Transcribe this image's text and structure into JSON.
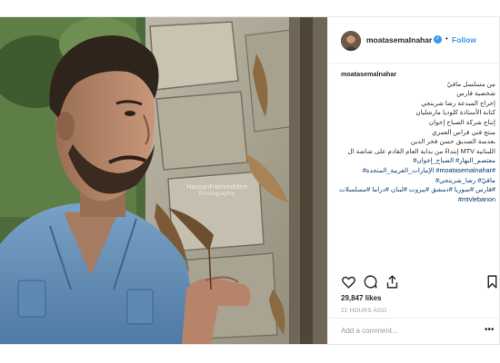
{
  "post": {
    "username": "moatasemalnahar",
    "follow_label": "Follow",
    "separator": "•",
    "verified_icon": "verified-badge-icon",
    "photo": {
      "watermark_name": "HassanFakhreddine",
      "watermark_sub": "Photography"
    },
    "caption": {
      "username": "moatasemalnahar",
      "lines": [
        "من مسلسل مافيّ",
        "شخصية فارس",
        "إخراج المبدعة رشا شربتجي",
        "كتابة الأستاذة كلوديا مارشليان",
        "إنتاج شركة الصباح إخوان",
        "منتج فني فراس العمري",
        "بعدسة الصديق حسن فخر الدين",
        "اللبنانية MTV إبتداءً من بداية العام القادم على شاشة ال",
        "معتصم_النهار# الصباح_إخوان#",
        "#moatasemalnahar# الإمارات_العربية_المتحدة#",
        "مافيّ# رشا_شربتجي#",
        "#فارس #سوريا #دمشق #بيروت #لبنان #دراما #مسلسلات",
        "#mtvlebanon"
      ]
    },
    "actions": {
      "like_icon": "heart-icon",
      "comment_icon": "comment-icon",
      "share_icon": "share-icon",
      "save_icon": "bookmark-icon"
    },
    "likes": "29,847 likes",
    "timestamp": "22 HOURS AGO",
    "comment_placeholder": "Add a comment...",
    "more_label": "•••",
    "colors": {
      "accent": "#3897f0",
      "text": "#262626",
      "muted": "#999999"
    }
  }
}
